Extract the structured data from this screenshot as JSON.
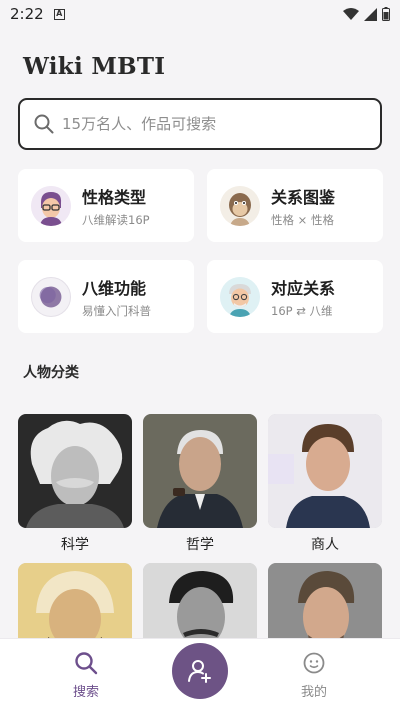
{
  "status_bar": {
    "time": "2:22",
    "notification_glyph": "A"
  },
  "app": {
    "title": "Wiki MBTI"
  },
  "search": {
    "placeholder": "15万名人、作品可搜索"
  },
  "cards": [
    {
      "title": "性格类型",
      "subtitle": "八维解读16P",
      "icon": "avatar-glasses-icon"
    },
    {
      "title": "关系图鉴",
      "subtitle": "性格 × 性格",
      "icon": "monkey-avatar-icon"
    },
    {
      "title": "八维功能",
      "subtitle": "易懂入门科普",
      "icon": "moon-circle-icon"
    },
    {
      "title": "对应关系",
      "subtitle": "16P ⇄ 八维",
      "icon": "elder-avatar-icon"
    }
  ],
  "section": {
    "title": "人物分类"
  },
  "categories": [
    {
      "label": "科学"
    },
    {
      "label": "哲学"
    },
    {
      "label": "商人"
    },
    {
      "label": ""
    },
    {
      "label": ""
    },
    {
      "label": ""
    }
  ],
  "nav": {
    "search_label": "搜索",
    "me_label": "我的"
  },
  "colors": {
    "accent": "#6d5385",
    "background": "#f5f4f6",
    "card": "#ffffff"
  }
}
